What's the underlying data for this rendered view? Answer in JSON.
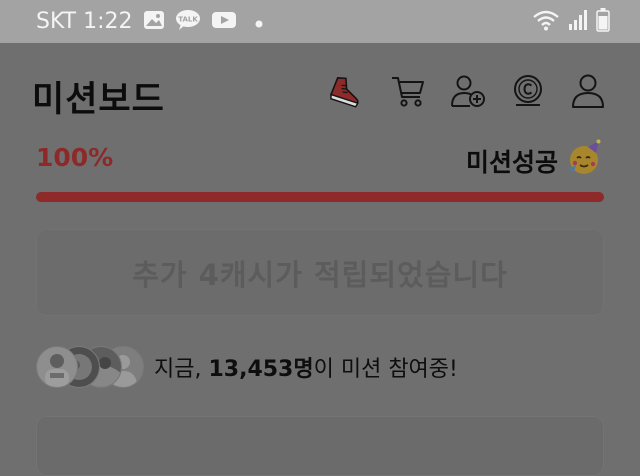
{
  "status_bar": {
    "carrier_time": "SKT 1:22",
    "left_icons": [
      "gallery-icon",
      "kakaotalk-icon",
      "youtube-icon",
      "notification-dot-icon"
    ],
    "kakaotalk_label": "TALK",
    "right_icons": [
      "wifi-icon",
      "signal-icon",
      "battery-icon"
    ]
  },
  "header": {
    "title": "미션보드",
    "icons": [
      "sneaker-icon",
      "cart-icon",
      "add-friend-icon",
      "cash-icon",
      "profile-icon"
    ]
  },
  "progress": {
    "percent_label": "100%",
    "value": 1.0,
    "status": "미션성공",
    "status_emoji": "🥳"
  },
  "notice": {
    "text": "추가 4캐시가 적립되었습니다"
  },
  "participants": {
    "prefix": "지금, ",
    "count": "13,453명",
    "suffix": "이 미션 참여중!",
    "avatar_count": 4
  },
  "colors": {
    "accent": "#8f2a2a",
    "overlay": "#6f6f6f",
    "status_bar": "#a3a3a3"
  }
}
